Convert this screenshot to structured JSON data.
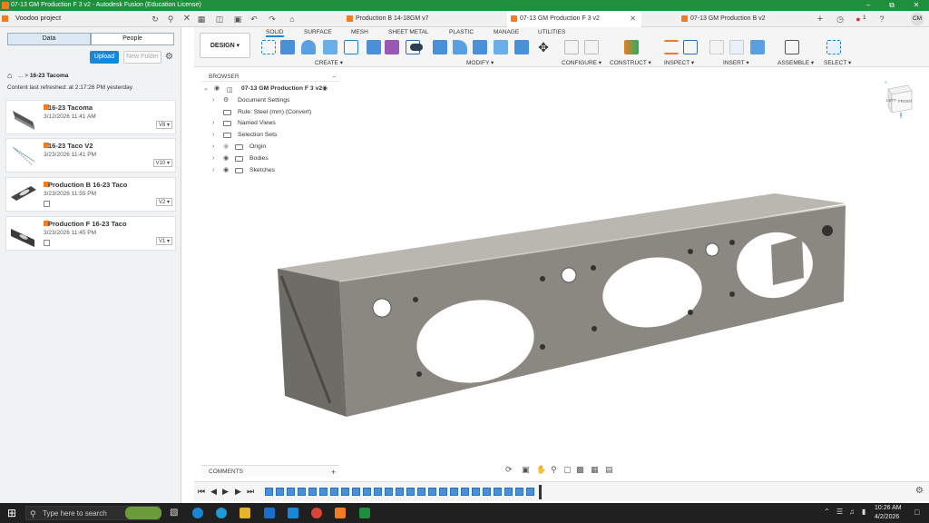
{
  "window": {
    "title": "07-13 GM Production F 3 v2 - Autodesk Fusion (Education License)"
  },
  "tabs": [
    {
      "label": "Production B 14-18GM v7"
    },
    {
      "label": "07-13 GM Production F 3 v2"
    },
    {
      "label": "07-13 GM Production B v2"
    }
  ],
  "account": {
    "initials": "CM",
    "notif_count": "1"
  },
  "datapanel": {
    "project": "Voodoo project",
    "seg_data": "Data",
    "seg_people": "People",
    "upload": "Upload",
    "new_folder": "New Folder",
    "breadcrumb_ellipsis": "...",
    "breadcrumb_current": "16-23 Tacoma",
    "refreshed": "Content last refreshed: at 2:17:26 PM yesterday",
    "files": [
      {
        "name": "16-23 Tacoma",
        "date": "3/12/2026 11:41 AM",
        "version": "V8"
      },
      {
        "name": "16-23 Taco V2",
        "date": "3/23/2026 11:41 PM",
        "version": "V10"
      },
      {
        "name": "Production B 16-23 Taco",
        "date": "3/23/2026 11:55 PM",
        "version": "V2"
      },
      {
        "name": "Production F 16-23 Taco",
        "date": "3/23/2026 11:45 PM",
        "version": "V1"
      }
    ]
  },
  "toolbar": {
    "workspace": "DESIGN",
    "tabs": [
      "SOLID",
      "SURFACE",
      "MESH",
      "SHEET METAL",
      "PLASTIC",
      "MANAGE",
      "UTILITIES"
    ],
    "groups": [
      "CREATE",
      "MODIFY",
      "CONFIGURE",
      "CONSTRUCT",
      "INSPECT",
      "INSERT",
      "ASSEMBLE",
      "SELECT"
    ]
  },
  "browser": {
    "header": "BROWSER",
    "root": "07-13 GM Production F 3 v2",
    "items": [
      "Document Settings",
      "Rule: Steel (mm) (Convert)",
      "Named Views",
      "Selection Sets",
      "Origin",
      "Bodies",
      "Sketches"
    ]
  },
  "viewcube": {
    "left": "LEFT",
    "front": "FRONT",
    "z": "Z",
    "x": "X"
  },
  "comments": {
    "label": "COMMENTS"
  },
  "taskbar": {
    "search_placeholder": "Type here to search",
    "time": "10:26 AM",
    "date": "4/2/2026"
  }
}
